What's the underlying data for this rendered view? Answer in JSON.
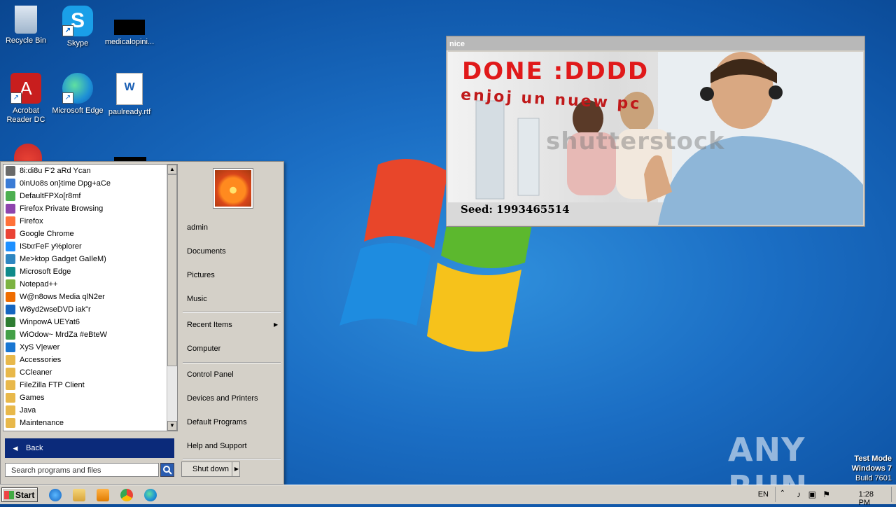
{
  "desktop": {
    "icons": [
      {
        "label": "Recycle Bin",
        "icon": "recycle-bin-icon"
      },
      {
        "label": "Skype",
        "icon": "skype-icon"
      },
      {
        "label": "medicalopini...",
        "icon": "file-icon"
      },
      {
        "label": "Acrobat Reader DC",
        "icon": "acrobat-icon"
      },
      {
        "label": "Microsoft Edge",
        "icon": "edge-icon"
      },
      {
        "label": "paulready.rtf",
        "icon": "word-document-icon"
      }
    ]
  },
  "popup": {
    "title": "nice",
    "headline": "DONE :DDDD",
    "subline": "enjoj un nuew pc",
    "watermark": "shutterstock",
    "seed": "Seed: 1993465514"
  },
  "start_menu": {
    "programs": [
      {
        "label": "8i:di8u F'2 aRd Ycan",
        "color": "#6a6a6a"
      },
      {
        "label": "0inUo8s on}time Dpg+aCe",
        "color": "#3a7bd5"
      },
      {
        "label": "DefaultFPXo[r8mf",
        "color": "#4caf50"
      },
      {
        "label": "Firefox Private Browsing",
        "color": "#8e44ad"
      },
      {
        "label": "Firefox",
        "color": "#ff7139"
      },
      {
        "label": "Google Chrome",
        "color": "#ea4335"
      },
      {
        "label": "IStxrFeF y%plorer",
        "color": "#1e90ff"
      },
      {
        "label": "Me>ktop Gadget GaIleM)",
        "color": "#2e86c1"
      },
      {
        "label": "Microsoft Edge",
        "color": "#0f8a8a"
      },
      {
        "label": "Notepad++",
        "color": "#7cb342"
      },
      {
        "label": "W@n8ows Media qlN2er",
        "color": "#ef6c00"
      },
      {
        "label": "W8yd2wseDVD iak\"r",
        "color": "#1565c0"
      },
      {
        "label": "WinpowA UEYat6",
        "color": "#2e7d32"
      },
      {
        "label": "WiOdow~ MrdZa #eBteW",
        "color": "#43a047"
      },
      {
        "label": "XyS V|ewer",
        "color": "#1976d2"
      },
      {
        "label": "Accessories",
        "color": "#e8b84a"
      },
      {
        "label": "CCleaner",
        "color": "#e8b84a"
      },
      {
        "label": "FileZilla FTP Client",
        "color": "#e8b84a"
      },
      {
        "label": "Games",
        "color": "#e8b84a"
      },
      {
        "label": "Java",
        "color": "#e8b84a"
      },
      {
        "label": "Maintenance",
        "color": "#e8b84a"
      }
    ],
    "back_label": "Back",
    "search_placeholder": "Search programs and files",
    "right": {
      "user": "admin",
      "documents": "Documents",
      "pictures": "Pictures",
      "music": "Music",
      "recent": "Recent Items",
      "computer": "Computer",
      "control_panel": "Control Panel",
      "devices": "Devices and Printers",
      "default_programs": "Default Programs",
      "help": "Help and Support"
    },
    "shutdown_label": "Shut down"
  },
  "taskbar": {
    "start_label": "Start",
    "language": "EN",
    "time": "1:28 PM"
  },
  "overlay": {
    "anyrun": "ANY RUN",
    "test_mode": "Test Mode",
    "os": "Windows 7",
    "build": "Build 7601"
  }
}
